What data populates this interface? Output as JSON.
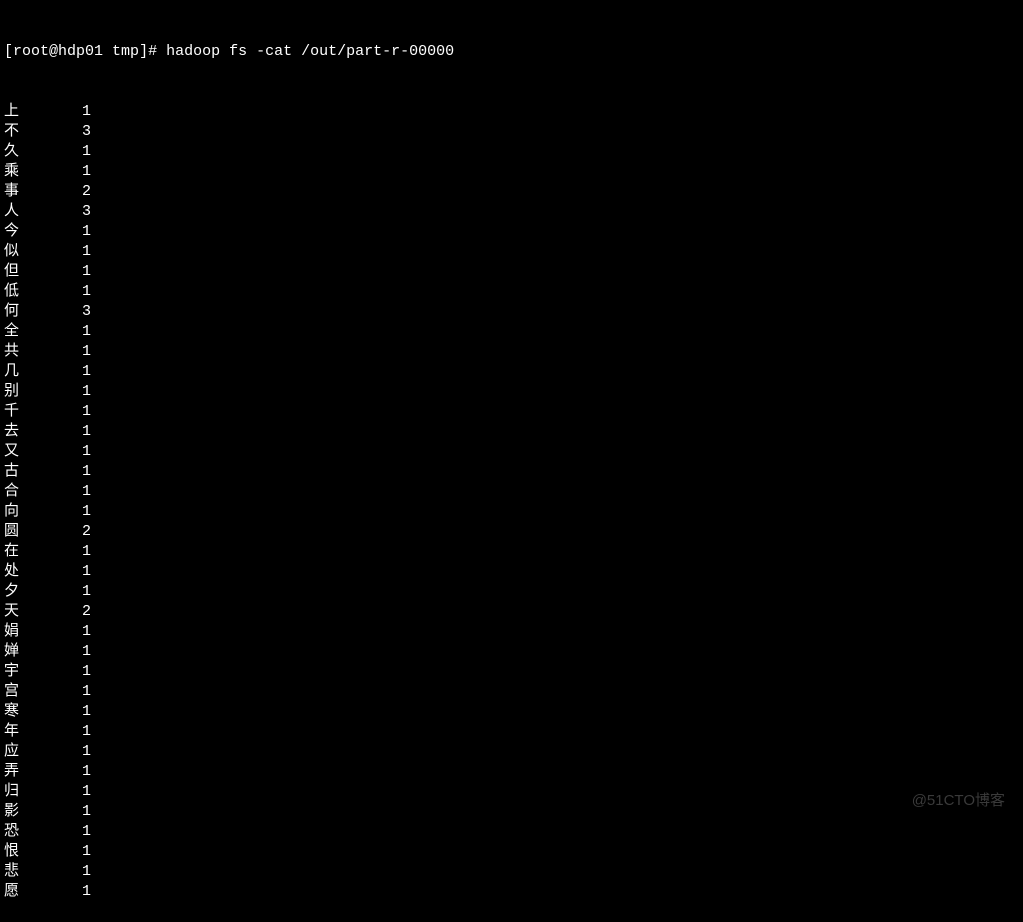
{
  "prompt": {
    "user_host": "root@hdp01",
    "path": "tmp",
    "symbol": "#",
    "command": "hadoop fs -cat /out/part-r-00000"
  },
  "output_rows": [
    {
      "char": "上",
      "count": "1"
    },
    {
      "char": "不",
      "count": "3"
    },
    {
      "char": "久",
      "count": "1"
    },
    {
      "char": "乘",
      "count": "1"
    },
    {
      "char": "事",
      "count": "2"
    },
    {
      "char": "人",
      "count": "3"
    },
    {
      "char": "今",
      "count": "1"
    },
    {
      "char": "似",
      "count": "1"
    },
    {
      "char": "但",
      "count": "1"
    },
    {
      "char": "低",
      "count": "1"
    },
    {
      "char": "何",
      "count": "3"
    },
    {
      "char": "全",
      "count": "1"
    },
    {
      "char": "共",
      "count": "1"
    },
    {
      "char": "几",
      "count": "1"
    },
    {
      "char": "别",
      "count": "1"
    },
    {
      "char": "千",
      "count": "1"
    },
    {
      "char": "去",
      "count": "1"
    },
    {
      "char": "又",
      "count": "1"
    },
    {
      "char": "古",
      "count": "1"
    },
    {
      "char": "合",
      "count": "1"
    },
    {
      "char": "向",
      "count": "1"
    },
    {
      "char": "圆",
      "count": "2"
    },
    {
      "char": "在",
      "count": "1"
    },
    {
      "char": "处",
      "count": "1"
    },
    {
      "char": "夕",
      "count": "1"
    },
    {
      "char": "天",
      "count": "2"
    },
    {
      "char": "娟",
      "count": "1"
    },
    {
      "char": "婵",
      "count": "1"
    },
    {
      "char": "宇",
      "count": "1"
    },
    {
      "char": "宫",
      "count": "1"
    },
    {
      "char": "寒",
      "count": "1"
    },
    {
      "char": "年",
      "count": "1"
    },
    {
      "char": "应",
      "count": "1"
    },
    {
      "char": "弄",
      "count": "1"
    },
    {
      "char": "归",
      "count": "1"
    },
    {
      "char": "影",
      "count": "1"
    },
    {
      "char": "恐",
      "count": "1"
    },
    {
      "char": "恨",
      "count": "1"
    },
    {
      "char": "悲",
      "count": "1"
    },
    {
      "char": "愿",
      "count": "1"
    }
  ],
  "watermark": "@51CTO博客"
}
